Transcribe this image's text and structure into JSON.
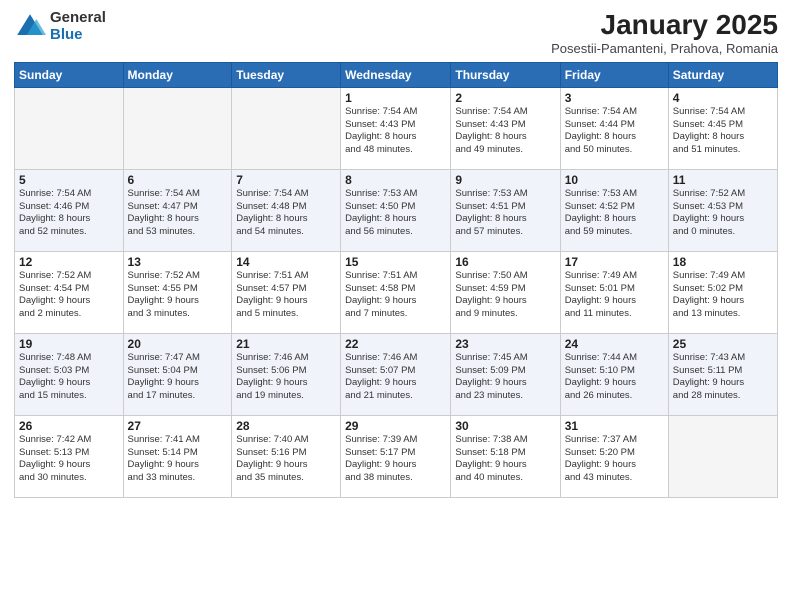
{
  "logo": {
    "general": "General",
    "blue": "Blue"
  },
  "title": "January 2025",
  "subtitle": "Posestii-Pamanteni, Prahova, Romania",
  "weekdays": [
    "Sunday",
    "Monday",
    "Tuesday",
    "Wednesday",
    "Thursday",
    "Friday",
    "Saturday"
  ],
  "weeks": [
    [
      {
        "day": "",
        "info": ""
      },
      {
        "day": "",
        "info": ""
      },
      {
        "day": "",
        "info": ""
      },
      {
        "day": "1",
        "info": "Sunrise: 7:54 AM\nSunset: 4:43 PM\nDaylight: 8 hours\nand 48 minutes."
      },
      {
        "day": "2",
        "info": "Sunrise: 7:54 AM\nSunset: 4:43 PM\nDaylight: 8 hours\nand 49 minutes."
      },
      {
        "day": "3",
        "info": "Sunrise: 7:54 AM\nSunset: 4:44 PM\nDaylight: 8 hours\nand 50 minutes."
      },
      {
        "day": "4",
        "info": "Sunrise: 7:54 AM\nSunset: 4:45 PM\nDaylight: 8 hours\nand 51 minutes."
      }
    ],
    [
      {
        "day": "5",
        "info": "Sunrise: 7:54 AM\nSunset: 4:46 PM\nDaylight: 8 hours\nand 52 minutes."
      },
      {
        "day": "6",
        "info": "Sunrise: 7:54 AM\nSunset: 4:47 PM\nDaylight: 8 hours\nand 53 minutes."
      },
      {
        "day": "7",
        "info": "Sunrise: 7:54 AM\nSunset: 4:48 PM\nDaylight: 8 hours\nand 54 minutes."
      },
      {
        "day": "8",
        "info": "Sunrise: 7:53 AM\nSunset: 4:50 PM\nDaylight: 8 hours\nand 56 minutes."
      },
      {
        "day": "9",
        "info": "Sunrise: 7:53 AM\nSunset: 4:51 PM\nDaylight: 8 hours\nand 57 minutes."
      },
      {
        "day": "10",
        "info": "Sunrise: 7:53 AM\nSunset: 4:52 PM\nDaylight: 8 hours\nand 59 minutes."
      },
      {
        "day": "11",
        "info": "Sunrise: 7:52 AM\nSunset: 4:53 PM\nDaylight: 9 hours\nand 0 minutes."
      }
    ],
    [
      {
        "day": "12",
        "info": "Sunrise: 7:52 AM\nSunset: 4:54 PM\nDaylight: 9 hours\nand 2 minutes."
      },
      {
        "day": "13",
        "info": "Sunrise: 7:52 AM\nSunset: 4:55 PM\nDaylight: 9 hours\nand 3 minutes."
      },
      {
        "day": "14",
        "info": "Sunrise: 7:51 AM\nSunset: 4:57 PM\nDaylight: 9 hours\nand 5 minutes."
      },
      {
        "day": "15",
        "info": "Sunrise: 7:51 AM\nSunset: 4:58 PM\nDaylight: 9 hours\nand 7 minutes."
      },
      {
        "day": "16",
        "info": "Sunrise: 7:50 AM\nSunset: 4:59 PM\nDaylight: 9 hours\nand 9 minutes."
      },
      {
        "day": "17",
        "info": "Sunrise: 7:49 AM\nSunset: 5:01 PM\nDaylight: 9 hours\nand 11 minutes."
      },
      {
        "day": "18",
        "info": "Sunrise: 7:49 AM\nSunset: 5:02 PM\nDaylight: 9 hours\nand 13 minutes."
      }
    ],
    [
      {
        "day": "19",
        "info": "Sunrise: 7:48 AM\nSunset: 5:03 PM\nDaylight: 9 hours\nand 15 minutes."
      },
      {
        "day": "20",
        "info": "Sunrise: 7:47 AM\nSunset: 5:04 PM\nDaylight: 9 hours\nand 17 minutes."
      },
      {
        "day": "21",
        "info": "Sunrise: 7:46 AM\nSunset: 5:06 PM\nDaylight: 9 hours\nand 19 minutes."
      },
      {
        "day": "22",
        "info": "Sunrise: 7:46 AM\nSunset: 5:07 PM\nDaylight: 9 hours\nand 21 minutes."
      },
      {
        "day": "23",
        "info": "Sunrise: 7:45 AM\nSunset: 5:09 PM\nDaylight: 9 hours\nand 23 minutes."
      },
      {
        "day": "24",
        "info": "Sunrise: 7:44 AM\nSunset: 5:10 PM\nDaylight: 9 hours\nand 26 minutes."
      },
      {
        "day": "25",
        "info": "Sunrise: 7:43 AM\nSunset: 5:11 PM\nDaylight: 9 hours\nand 28 minutes."
      }
    ],
    [
      {
        "day": "26",
        "info": "Sunrise: 7:42 AM\nSunset: 5:13 PM\nDaylight: 9 hours\nand 30 minutes."
      },
      {
        "day": "27",
        "info": "Sunrise: 7:41 AM\nSunset: 5:14 PM\nDaylight: 9 hours\nand 33 minutes."
      },
      {
        "day": "28",
        "info": "Sunrise: 7:40 AM\nSunset: 5:16 PM\nDaylight: 9 hours\nand 35 minutes."
      },
      {
        "day": "29",
        "info": "Sunrise: 7:39 AM\nSunset: 5:17 PM\nDaylight: 9 hours\nand 38 minutes."
      },
      {
        "day": "30",
        "info": "Sunrise: 7:38 AM\nSunset: 5:18 PM\nDaylight: 9 hours\nand 40 minutes."
      },
      {
        "day": "31",
        "info": "Sunrise: 7:37 AM\nSunset: 5:20 PM\nDaylight: 9 hours\nand 43 minutes."
      },
      {
        "day": "",
        "info": ""
      }
    ]
  ]
}
